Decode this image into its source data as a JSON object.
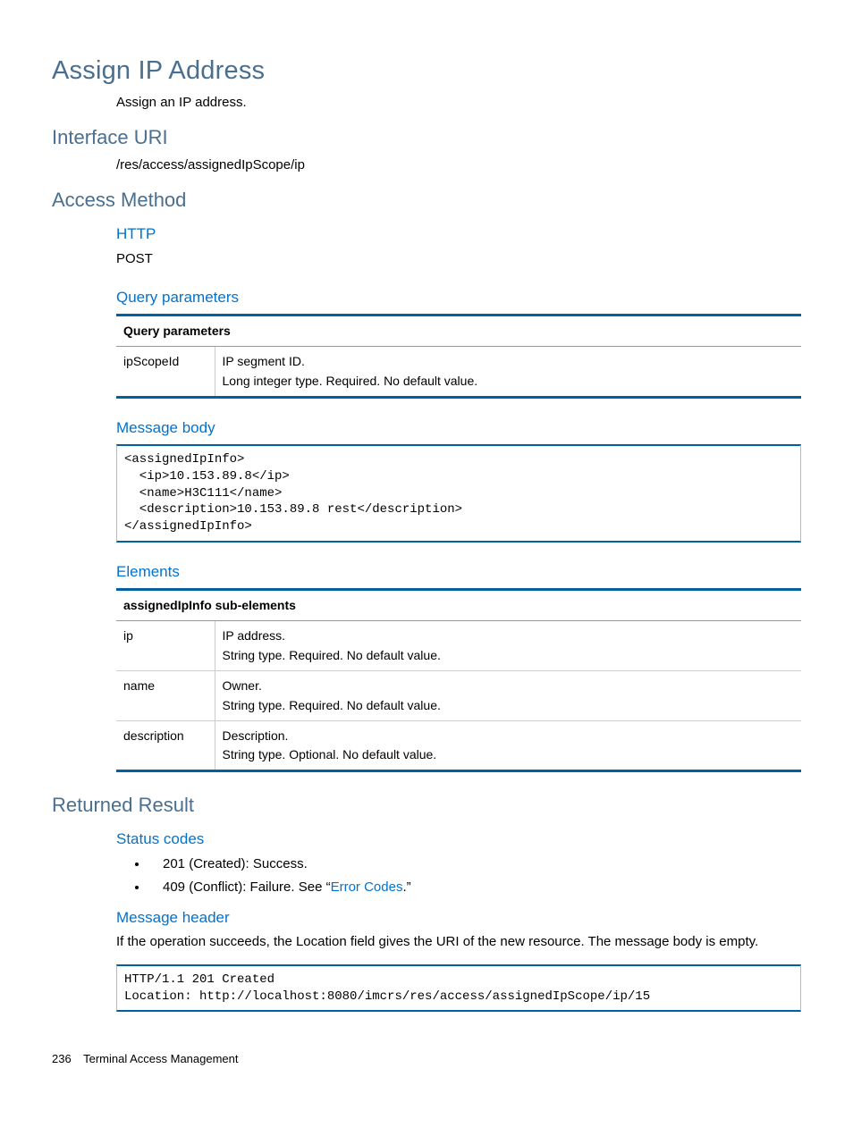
{
  "title": "Assign IP Address",
  "intro": "Assign an IP address.",
  "interfaceUri": {
    "heading": "Interface URI",
    "value": "/res/access/assignedIpScope/ip"
  },
  "accessMethod": {
    "heading": "Access Method",
    "httpHeading": "HTTP",
    "httpValue": "POST",
    "queryHeading": "Query parameters",
    "queryTable": {
      "caption": "Query parameters",
      "rows": [
        {
          "name": "ipScopeId",
          "line1": "IP segment ID.",
          "line2": "Long integer type. Required. No default value."
        }
      ]
    },
    "messageBodyHeading": "Message body",
    "messageBodyCode": "<assignedIpInfo>\n  <ip>10.153.89.8</ip>\n  <name>H3C111</name>\n  <description>10.153.89.8 rest</description>\n</assignedIpInfo>",
    "elementsHeading": "Elements",
    "elementsTable": {
      "caption": "assignedIpInfo sub-elements",
      "rows": [
        {
          "name": "ip",
          "line1": "IP address.",
          "line2": "String type. Required. No default value."
        },
        {
          "name": "name",
          "line1": "Owner.",
          "line2": "String type. Required. No default value."
        },
        {
          "name": "description",
          "line1": "Description.",
          "line2": "String type. Optional. No default value."
        }
      ]
    }
  },
  "returnedResult": {
    "heading": "Returned Result",
    "statusHeading": "Status codes",
    "status": [
      {
        "prefix": "201 (Created): Success."
      },
      {
        "prefix": "409 (Conflict): Failure. See “",
        "link": "Error Codes",
        "suffix": ".”"
      }
    ],
    "messageHeaderHeading": "Message header",
    "messageHeaderText": "If the operation succeeds, the Location field gives the URI of the new resource. The message body is empty.",
    "messageHeaderCode": "HTTP/1.1 201 Created\nLocation: http://localhost:8080/imcrs/res/access/assignedIpScope/ip/15"
  },
  "footer": {
    "page": "236",
    "section": "Terminal Access Management"
  }
}
